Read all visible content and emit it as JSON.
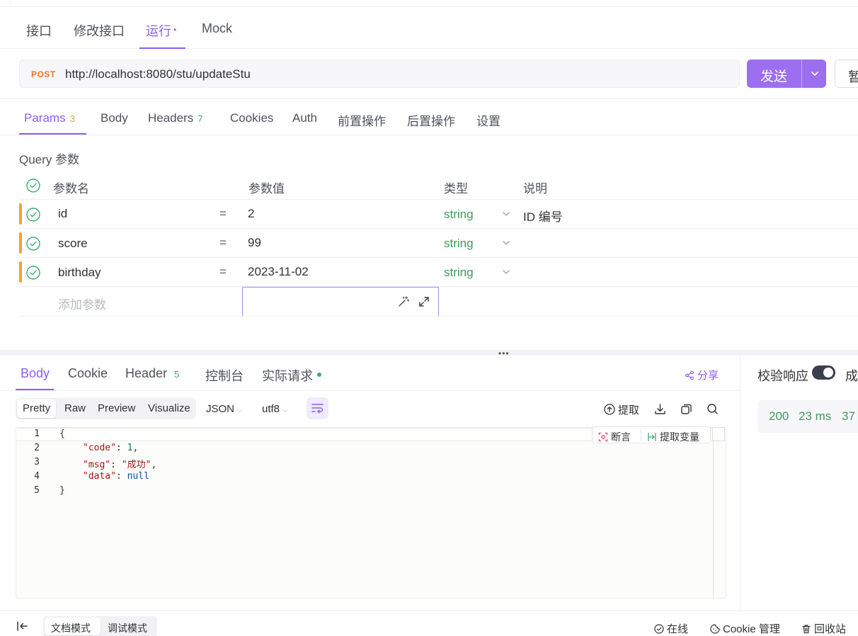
{
  "main_tabs": [
    {
      "label": "接口"
    },
    {
      "label": "修改接口"
    },
    {
      "label": "运行"
    },
    {
      "label": "Mock"
    }
  ],
  "main_tab_dot": "•",
  "request": {
    "method": "POST",
    "url": "http://localhost:8080/stu/updateStu",
    "send_label": "发送",
    "save_label": "暂"
  },
  "request_tabs": {
    "params": {
      "label": "Params",
      "count": "3"
    },
    "body": {
      "label": "Body"
    },
    "headers": {
      "label": "Headers",
      "count": "7"
    },
    "cookies": {
      "label": "Cookies"
    },
    "auth": {
      "label": "Auth"
    },
    "pre_ops": {
      "label": "前置操作"
    },
    "post_ops": {
      "label": "后置操作"
    },
    "settings": {
      "label": "设置"
    }
  },
  "query": {
    "title": "Query 参数",
    "columns": {
      "name": "参数名",
      "value": "参数值",
      "type": "类型",
      "desc": "说明"
    },
    "rows": [
      {
        "name": "id",
        "eq": "=",
        "value": "2",
        "type": "string",
        "desc": "ID 编号"
      },
      {
        "name": "score",
        "eq": "=",
        "value": "99",
        "type": "string",
        "desc": ""
      },
      {
        "name": "birthday",
        "eq": "=",
        "value": "2023-11-02",
        "type": "string",
        "desc": ""
      }
    ],
    "add_placeholder": "添加参数"
  },
  "split_grip": "•••",
  "response_tabs": {
    "body": {
      "label": "Body"
    },
    "cookie": {
      "label": "Cookie"
    },
    "header": {
      "label": "Header",
      "count": "5"
    },
    "console": {
      "label": "控制台"
    },
    "actual": {
      "label": "实际请求"
    }
  },
  "share_label": "分享",
  "format_toolbar": {
    "modes": [
      "Pretty",
      "Raw",
      "Preview",
      "Visualize"
    ],
    "format": "JSON",
    "encoding": "utf8",
    "extract": "提取"
  },
  "code": {
    "line_numbers": [
      "1",
      "2",
      "3",
      "4",
      "5"
    ],
    "lines": {
      "l1": "{",
      "l2_key": "\"code\"",
      "l2_val": "1",
      "l3_key": "\"msg\"",
      "l3_val": "\"成功\"",
      "l4_key": "\"data\"",
      "l4_val": "null",
      "l5": "}"
    },
    "assert_label": "断言",
    "extract_var_label": "提取变量"
  },
  "validate": {
    "label": "校验响应",
    "result_cut": "成",
    "toggle_on": true
  },
  "stats": {
    "status": "200",
    "time": "23 ms",
    "size": "37"
  },
  "footer": {
    "doc_mode": "文档模式",
    "debug_mode": "调试模式",
    "online": "在线",
    "cookie_mgmt": "Cookie 管理",
    "recycle": "回收站"
  },
  "colors": {
    "accent": "#8b5cf6",
    "send_button": "#9c6ef0",
    "method_post": "#e8762b",
    "type_string": "#3b9b5a",
    "row_marker": "#f3a32d"
  }
}
